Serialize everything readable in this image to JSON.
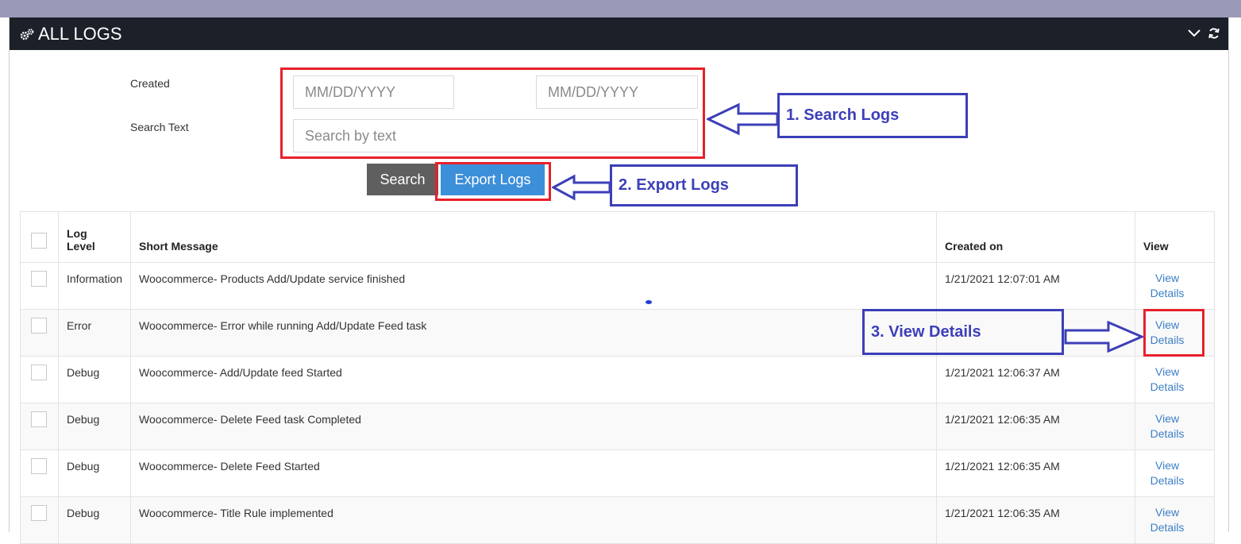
{
  "header": {
    "title": "ALL LOGS",
    "icon": "gears-icon",
    "tools": [
      "chevron-down-icon",
      "refresh-icon"
    ]
  },
  "filters": {
    "created_label": "Created",
    "date_from_placeholder": "MM/DD/YYYY",
    "date_to_placeholder": "MM/DD/YYYY",
    "search_text_label": "Search Text",
    "search_placeholder": "Search by text"
  },
  "buttons": {
    "search": "Search",
    "export": "Export Logs"
  },
  "annotations": {
    "search_logs": "1. Search Logs",
    "export_logs": "2. Export Logs",
    "view_details": "3. View Details"
  },
  "table": {
    "columns": [
      "Log Level",
      "Short Message",
      "Created on",
      "View"
    ],
    "log_level_header_line1": "Log",
    "log_level_header_line2": "Level",
    "view_line1": "View",
    "view_line2": "Details",
    "rows": [
      {
        "level": "Information",
        "message": "Woocommerce- Products Add/Update service finished",
        "created": "1/21/2021 12:07:01 AM"
      },
      {
        "level": "Error",
        "message": "Woocommerce- Error while running Add/Update Feed task",
        "created": ""
      },
      {
        "level": "Debug",
        "message": "Woocommerce- Add/Update feed Started",
        "created": "1/21/2021 12:06:37 AM"
      },
      {
        "level": "Debug",
        "message": "Woocommerce- Delete Feed task Completed",
        "created": "1/21/2021 12:06:35 AM"
      },
      {
        "level": "Debug",
        "message": "Woocommerce- Delete Feed Started",
        "created": "1/21/2021 12:06:35 AM"
      },
      {
        "level": "Debug",
        "message": "Woocommerce- Title Rule implemented",
        "created": "1/21/2021 12:06:35 AM"
      }
    ]
  },
  "colors": {
    "header_bg": "#1c2029",
    "highlight_red": "#e8202a",
    "annotation_blue": "#3c3fb8",
    "export_button": "#3c8fd9",
    "search_button": "#5f5f5f",
    "link": "#3c7fc4"
  }
}
